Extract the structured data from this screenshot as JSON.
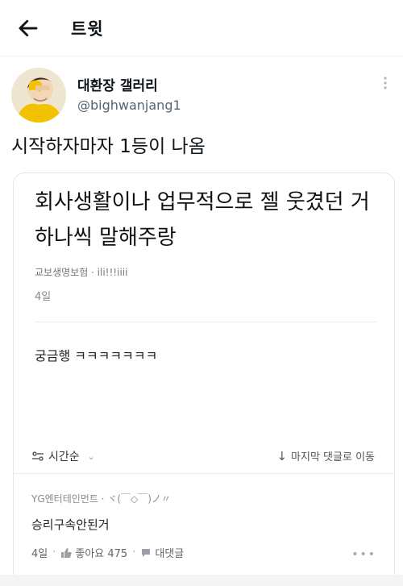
{
  "header": {
    "title": "트윗"
  },
  "tweet": {
    "author_name": "대환장 갤러리",
    "author_handle": "@bighwanjang1",
    "text": "시작하자마자 1등이 나옴"
  },
  "post": {
    "title": "회사생활이나 업무적으로 젤 웃겼던 거 하나씩 말해주랑",
    "meta": "교보생명보험 · ili!!!iiii",
    "date": "4일",
    "comment": "궁금행 ㅋㅋㅋㅋㅋㅋㅋ",
    "sort_label": "시간순",
    "jump_label": "마지막 댓글로 이동"
  },
  "reply": {
    "author": "YG엔터테인먼트 · ヾ(￣◇￣)ノ〃",
    "text": "승리구속안된거",
    "date": "4일",
    "likes_label": "좋아요 475",
    "reply_label": "대댓글"
  },
  "colors": {
    "accent_yellow": "#f2c200",
    "muted_text": "#536471"
  }
}
